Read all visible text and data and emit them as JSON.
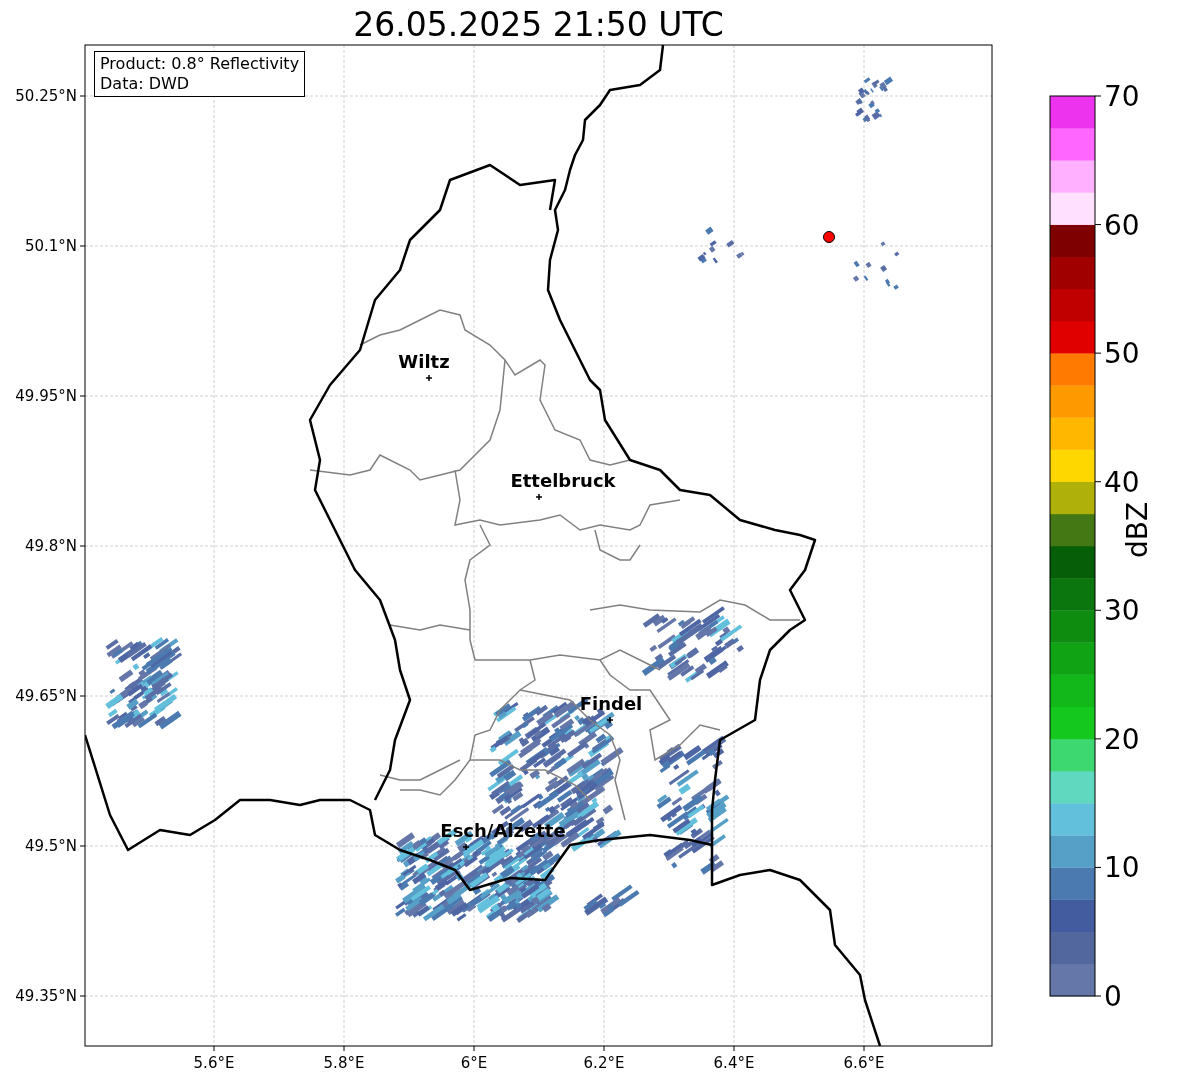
{
  "title": "26.05.2025 21:50 UTC",
  "info_box": [
    "Product: 0.8° Reflectivity",
    "Data: DWD"
  ],
  "lat_ticks": [
    "50.25°N",
    "50.1°N",
    "49.95°N",
    "49.8°N",
    "49.65°N",
    "49.5°N",
    "49.35°N"
  ],
  "lon_ticks": [
    "5.6°E",
    "5.8°E",
    "6°E",
    "6.2°E",
    "6.4°E",
    "6.6°E"
  ],
  "cities": [
    "Wiltz",
    "Ettelbruck",
    "Findel",
    "Esch/Alzette"
  ],
  "colorbar": {
    "label": "dBZ",
    "ticks": [
      "70",
      "60",
      "50",
      "40",
      "30",
      "20",
      "10",
      "0"
    ],
    "bins": [
      {
        "color": "#6477a8"
      },
      {
        "color": "#53679f"
      },
      {
        "color": "#435ca0"
      },
      {
        "color": "#4a7ab0"
      },
      {
        "color": "#56a0c8"
      },
      {
        "color": "#62c0dc"
      },
      {
        "color": "#60d8c0"
      },
      {
        "color": "#3ed870"
      },
      {
        "color": "#14c81e"
      },
      {
        "color": "#12b81a"
      },
      {
        "color": "#10a414"
      },
      {
        "color": "#0e8c10"
      },
      {
        "color": "#0b760d"
      },
      {
        "color": "#075e08"
      },
      {
        "color": "#437815"
      },
      {
        "color": "#b0b00a"
      },
      {
        "color": "#ffd700"
      },
      {
        "color": "#ffb700"
      },
      {
        "color": "#ff9900"
      },
      {
        "color": "#ff7a00"
      },
      {
        "color": "#e00000"
      },
      {
        "color": "#c00000"
      },
      {
        "color": "#a00000"
      },
      {
        "color": "#7f0000"
      },
      {
        "color": "#ffe0ff"
      },
      {
        "color": "#ffb0ff"
      },
      {
        "color": "#ff66ff"
      },
      {
        "color": "#ee33ee"
      }
    ]
  }
}
